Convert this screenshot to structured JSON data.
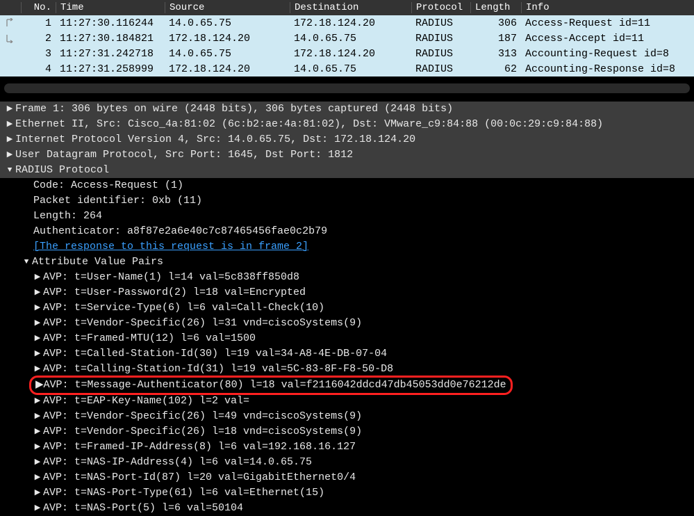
{
  "columns": {
    "no": "No.",
    "time": "Time",
    "source": "Source",
    "destination": "Destination",
    "protocol": "Protocol",
    "length": "Length",
    "info": "Info"
  },
  "packets": [
    {
      "no": "1",
      "time": "11:27:30.116244",
      "src": "14.0.65.75",
      "dst": "172.18.124.20",
      "proto": "RADIUS",
      "len": "306",
      "info": "Access-Request id=11"
    },
    {
      "no": "2",
      "time": "11:27:30.184821",
      "src": "172.18.124.20",
      "dst": "14.0.65.75",
      "proto": "RADIUS",
      "len": "187",
      "info": "Access-Accept id=11"
    },
    {
      "no": "3",
      "time": "11:27:31.242718",
      "src": "14.0.65.75",
      "dst": "172.18.124.20",
      "proto": "RADIUS",
      "len": "313",
      "info": "Accounting-Request id=8"
    },
    {
      "no": "4",
      "time": "11:27:31.258999",
      "src": "172.18.124.20",
      "dst": "14.0.65.75",
      "proto": "RADIUS",
      "len": "62",
      "info": "Accounting-Response id=8"
    }
  ],
  "tree": {
    "frame": "Frame 1: 306 bytes on wire (2448 bits), 306 bytes captured (2448 bits)",
    "eth": "Ethernet II, Src: Cisco_4a:81:02 (6c:b2:ae:4a:81:02), Dst: VMware_c9:84:88 (00:0c:29:c9:84:88)",
    "ip": "Internet Protocol Version 4, Src: 14.0.65.75, Dst: 172.18.124.20",
    "udp": "User Datagram Protocol, Src Port: 1645, Dst Port: 1812",
    "radius_label": "RADIUS Protocol",
    "radius": {
      "code": "Code: Access-Request (1)",
      "pkt_id": "Packet identifier: 0xb (11)",
      "length": "Length: 264",
      "auth": "Authenticator: a8f87e2a6e40c7c87465456fae0c2b79",
      "response_link": "[The response to this request is in frame 2]",
      "avp_label": "Attribute Value Pairs",
      "avps": [
        "AVP: t=User-Name(1) l=14 val=5c838ff850d8",
        "AVP: t=User-Password(2) l=18 val=Encrypted",
        "AVP: t=Service-Type(6) l=6 val=Call-Check(10)",
        "AVP: t=Vendor-Specific(26) l=31 vnd=ciscoSystems(9)",
        "AVP: t=Framed-MTU(12) l=6 val=1500",
        "AVP: t=Called-Station-Id(30) l=19 val=34-A8-4E-DB-07-04",
        "AVP: t=Calling-Station-Id(31) l=19 val=5C-83-8F-F8-50-D8",
        "AVP: t=Message-Authenticator(80) l=18 val=f2116042ddcd47db45053dd0e76212de",
        "AVP: t=EAP-Key-Name(102) l=2 val=",
        "AVP: t=Vendor-Specific(26) l=49 vnd=ciscoSystems(9)",
        "AVP: t=Vendor-Specific(26) l=18 vnd=ciscoSystems(9)",
        "AVP: t=Framed-IP-Address(8) l=6 val=192.168.16.127",
        "AVP: t=NAS-IP-Address(4) l=6 val=14.0.65.75",
        "AVP: t=NAS-Port-Id(87) l=20 val=GigabitEthernet0/4",
        "AVP: t=NAS-Port-Type(61) l=6 val=Ethernet(15)",
        "AVP: t=NAS-Port(5) l=6 val=50104"
      ]
    }
  }
}
